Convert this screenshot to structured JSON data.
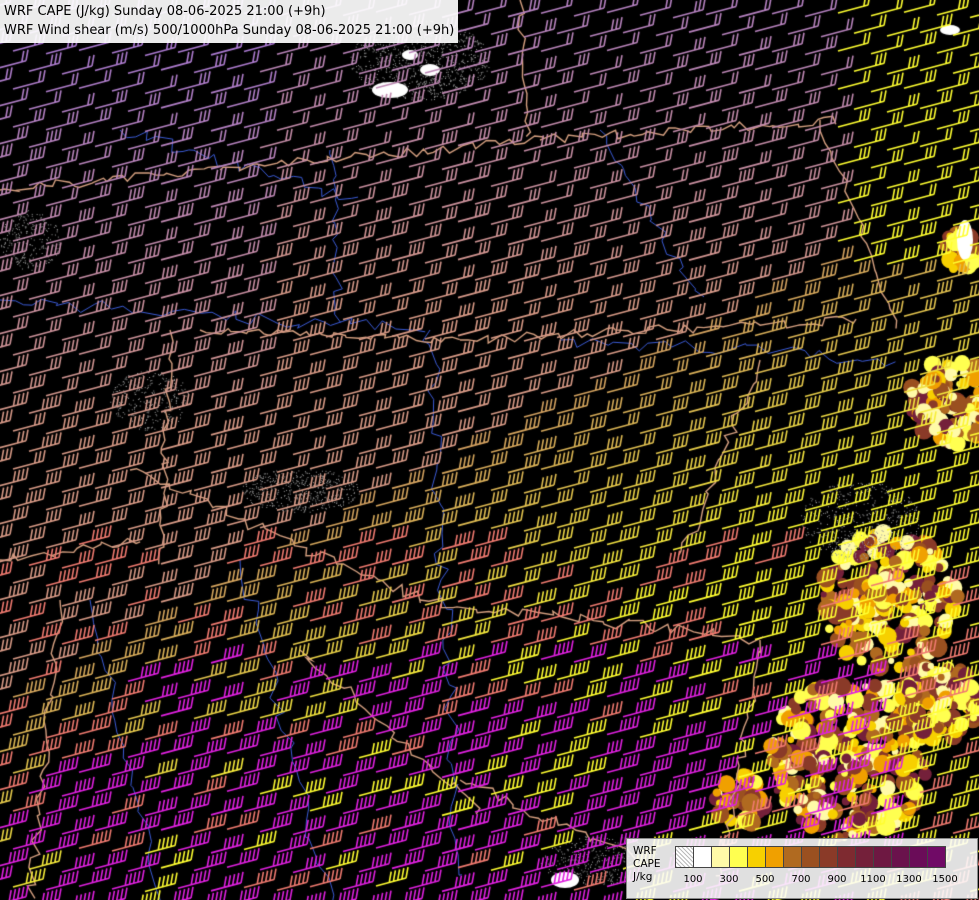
{
  "titles": {
    "line1": "WRF CAPE (J/kg) Sunday 08-06-2025 21:00 (+9h)",
    "line2": "WRF Wind shear (m/s) 500/1000hPa Sunday 08-06-2025 21:00 (+9h)"
  },
  "legend": {
    "label_lines": [
      "WRF",
      "CAPE",
      "J/kg"
    ],
    "swatch_colors": [
      "#d8d8d8",
      "#ffffff",
      "#fffaa8",
      "#ffff50",
      "#f7d000",
      "#f0a000",
      "#b06a20",
      "#9a5020",
      "#8a3a28",
      "#7e2a30",
      "#74203a",
      "#6e1842",
      "#6a124c",
      "#6a0c58",
      "#700a66"
    ],
    "tick_labels": [
      "100",
      "300",
      "500",
      "700",
      "900",
      "1100",
      "1300",
      "1500"
    ]
  },
  "colors": {
    "background": "#000000",
    "borders": "#d6a080",
    "rivers": "#3b5bd6",
    "barb_low_shear": "#d89a86",
    "barb_purple": "#a878d6",
    "barb_yellow": "#ffff30",
    "barb_gold": "#d2a060",
    "barb_salmon": "#f07a70",
    "barb_magenta": "#e020e0"
  }
}
